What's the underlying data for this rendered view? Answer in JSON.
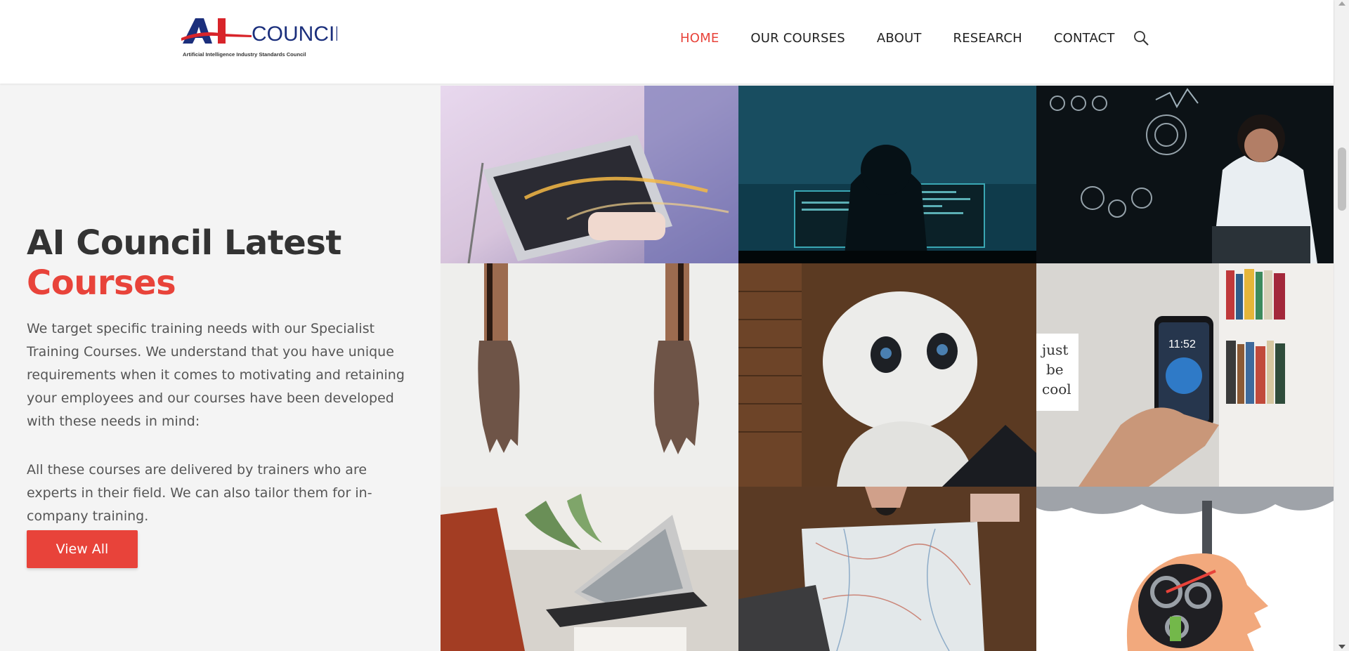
{
  "header": {
    "logo_text_ai": "AI",
    "logo_text_council": "COUNCIL",
    "logo_tagline": "Artificial Intelligence Industry Standards Council",
    "nav": [
      {
        "label": "HOME",
        "active": true
      },
      {
        "label": "OUR COURSES",
        "active": false
      },
      {
        "label": "ABOUT",
        "active": false
      },
      {
        "label": "RESEARCH",
        "active": false
      },
      {
        "label": "CONTACT",
        "active": false
      }
    ],
    "search_icon": "search-icon"
  },
  "main": {
    "heading_line1": "AI Council Latest",
    "heading_line2": "Courses",
    "paragraph1": "We target specific training needs with our Specialist Training Courses. We understand that you have unique requirements when it comes to motivating and retaining your employees and our courses have been developed with these needs in mind:",
    "paragraph2": "All these courses are delivered by trainers who are experts in their field. We can also tailor them for in-company training.",
    "button_label": "View All"
  },
  "screen_text": {
    "phone_time": "11:52",
    "poster_word1": "just",
    "poster_word2": "be",
    "poster_word3": "cool"
  },
  "colors": {
    "accent": "#e8433a",
    "heading": "#333333",
    "body_text": "#555555",
    "logo_blue": "#1b2f7c",
    "logo_red": "#d8242a"
  }
}
